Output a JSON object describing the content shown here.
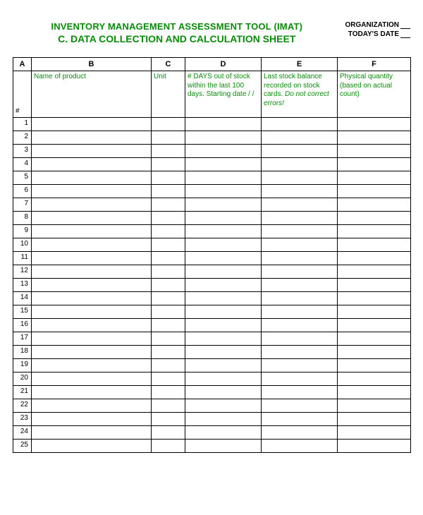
{
  "header": {
    "title1": "INVENTORY MANAGEMENT ASSESSMENT TOOL (IMAT)",
    "title2": "C. DATA COLLECTION AND CALCULATION SHEET",
    "meta_org_label": "ORGANIZATION",
    "meta_date_label": "TODAY'S DATE"
  },
  "columns": {
    "letters": [
      "A",
      "B",
      "C",
      "D",
      "E",
      "F"
    ],
    "a_label": "#",
    "b_label": "Name of product",
    "c_label": "Unit",
    "d_label": "# DAYS out of stock within the last 100 days. Starting date    /   /",
    "e_label_part1": "Last stock balance recorded on stock cards. ",
    "e_label_part2": "Do not correct errors!",
    "f_label": "Physical quantity (based on actual count)"
  },
  "row_numbers": [
    "1",
    "2",
    "3",
    "4",
    "5",
    "6",
    "7",
    "8",
    "9",
    "10",
    "11",
    "12",
    "13",
    "14",
    "15",
    "16",
    "17",
    "18",
    "19",
    "20",
    "21",
    "22",
    "23",
    "24",
    "25"
  ]
}
